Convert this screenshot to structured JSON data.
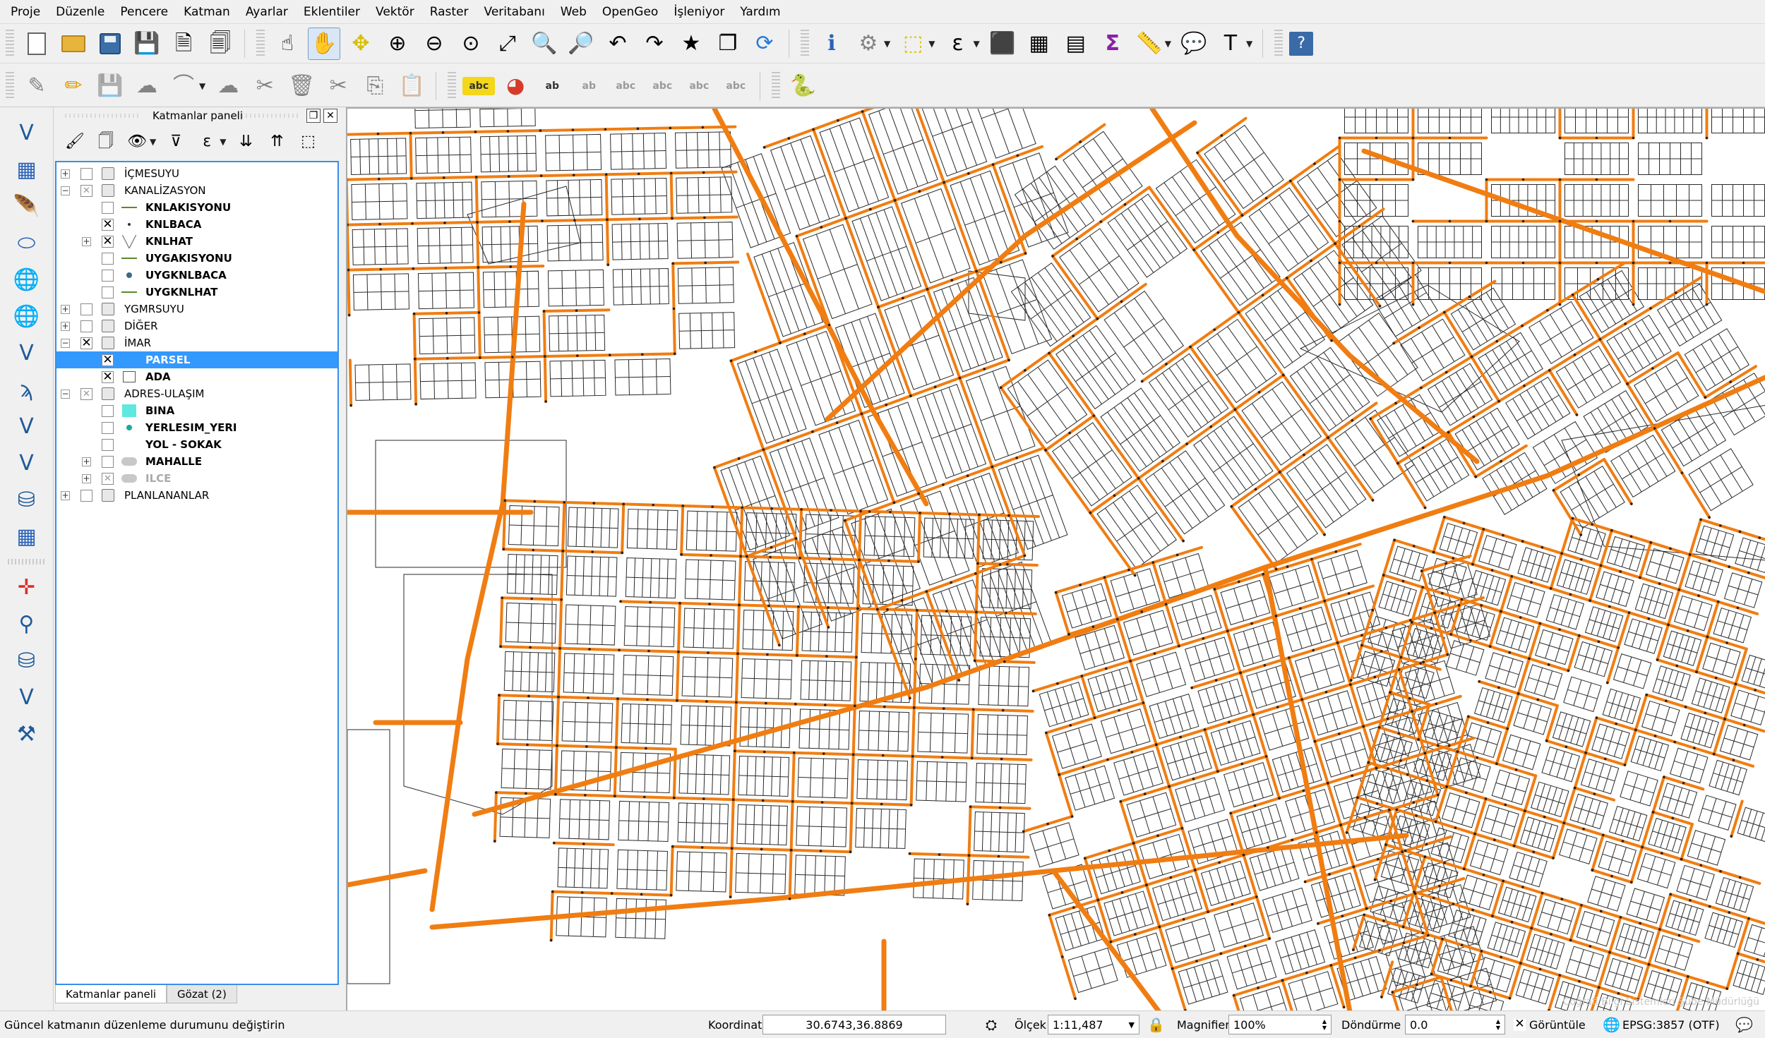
{
  "menu": [
    "Proje",
    "Düzenle",
    "Pencere",
    "Katman",
    "Ayarlar",
    "Eklentiler",
    "Vektör",
    "Raster",
    "Veritabanı",
    "Web",
    "OpenGeo",
    "İşleniyor",
    "Yardım"
  ],
  "toolbar1": [
    {
      "name": "new-project-icon",
      "glyph": ""
    },
    {
      "name": "open-project-icon",
      "glyph": ""
    },
    {
      "name": "save-project-icon",
      "glyph": ""
    },
    {
      "name": "save-as-icon",
      "glyph": "💾"
    },
    {
      "name": "new-print-composer-icon",
      "glyph": "🗎"
    },
    {
      "name": "composer-manager-icon",
      "glyph": "🗐"
    },
    {
      "name": "touch-zoom-icon",
      "glyph": "☝"
    },
    {
      "name": "pan-map-icon",
      "glyph": "✋",
      "active": true
    },
    {
      "name": "pan-to-selection-icon",
      "glyph": "✥"
    },
    {
      "name": "zoom-in-icon",
      "glyph": "⊕"
    },
    {
      "name": "zoom-out-icon",
      "glyph": "⊖"
    },
    {
      "name": "zoom-native-icon",
      "glyph": "⊙"
    },
    {
      "name": "zoom-full-icon",
      "glyph": "⤢"
    },
    {
      "name": "zoom-to-selection-icon",
      "glyph": "🔍"
    },
    {
      "name": "zoom-to-layer-icon",
      "glyph": "🔎"
    },
    {
      "name": "zoom-last-icon",
      "glyph": "↶"
    },
    {
      "name": "zoom-next-icon",
      "glyph": "↷"
    },
    {
      "name": "new-bookmark-icon",
      "glyph": "★"
    },
    {
      "name": "show-bookmarks-icon",
      "glyph": "❐"
    },
    {
      "name": "refresh-icon",
      "glyph": "⟳"
    },
    {
      "name": "identify-icon",
      "glyph": "ℹ"
    },
    {
      "name": "map-tips-icon",
      "glyph": "⚙",
      "dim": true,
      "dropdown": true
    },
    {
      "name": "select-features-icon",
      "glyph": "⬚",
      "dropdown": true
    },
    {
      "name": "select-by-expression-icon",
      "glyph": "ε",
      "dropdown": true
    },
    {
      "name": "deselect-all-icon",
      "glyph": "⬛"
    },
    {
      "name": "attribute-table-icon",
      "glyph": "▦"
    },
    {
      "name": "field-calculator-icon",
      "glyph": "▤"
    },
    {
      "name": "statistics-sum-icon",
      "glyph": "Σ"
    },
    {
      "name": "measure-line-icon",
      "glyph": "📏",
      "dropdown": true
    },
    {
      "name": "text-annotation-icon",
      "glyph": "💬"
    },
    {
      "name": "text-tool-icon",
      "glyph": "T",
      "dropdown": true
    },
    {
      "name": "help-icon",
      "glyph": "?"
    }
  ],
  "toolbar2": [
    {
      "name": "current-edits-icon",
      "glyph": "✎",
      "dim": true
    },
    {
      "name": "toggle-editing-icon",
      "glyph": "✏"
    },
    {
      "name": "save-layer-edits-icon",
      "glyph": "💾",
      "dim": true
    },
    {
      "name": "add-feature-icon",
      "glyph": "☁",
      "dim": true
    },
    {
      "name": "add-circular-string-icon",
      "glyph": "⌒",
      "dim": true,
      "dropdown": true
    },
    {
      "name": "move-feature-icon",
      "glyph": "☁",
      "dim": true
    },
    {
      "name": "node-tool-icon",
      "glyph": "✂",
      "dim": true
    },
    {
      "name": "delete-selected-icon",
      "glyph": "🗑",
      "dim": true
    },
    {
      "name": "cut-features-icon",
      "glyph": "✂",
      "dim": true
    },
    {
      "name": "copy-features-icon",
      "glyph": "⎘",
      "dim": true
    },
    {
      "name": "paste-features-icon",
      "glyph": "📋",
      "dim": true
    },
    {
      "name": "labeling-icon",
      "glyph": "abc"
    },
    {
      "name": "diagram-icon",
      "glyph": "◕"
    },
    {
      "name": "pin-labels-icon",
      "glyph": "ab"
    },
    {
      "name": "highlight-pinned-labels-icon",
      "glyph": "ab",
      "dim": true
    },
    {
      "name": "show-hide-labels-icon",
      "glyph": "abc",
      "dim": true
    },
    {
      "name": "move-label-icon",
      "glyph": "abc",
      "dim": true
    },
    {
      "name": "rotate-label-icon",
      "glyph": "abc",
      "dim": true
    },
    {
      "name": "change-label-icon",
      "glyph": "abc",
      "dim": true
    },
    {
      "name": "python-console-icon",
      "glyph": "🐍"
    }
  ],
  "leftbar": [
    {
      "name": "add-vector-layer-icon",
      "glyph": "V"
    },
    {
      "name": "add-raster-layer-icon",
      "glyph": "▦"
    },
    {
      "name": "add-delimited-text-icon",
      "glyph": "🪶"
    },
    {
      "name": "add-spatialite-layer-icon",
      "glyph": "⬭",
      "dropdown": true
    },
    {
      "name": "add-wms-layer-icon",
      "glyph": "🌐",
      "dropdown": true
    },
    {
      "name": "add-wcs-layer-icon",
      "glyph": "🌐"
    },
    {
      "name": "add-wfs-layer-icon",
      "glyph": "V",
      "dropdown": true
    },
    {
      "name": "add-csv-layer-icon",
      "glyph": "ϡ"
    },
    {
      "name": "new-shapefile-icon",
      "glyph": "V"
    },
    {
      "name": "new-spatialite-layer-icon",
      "glyph": "V",
      "dropdown": true
    },
    {
      "name": "add-wms-tile-icon",
      "glyph": "⛁"
    },
    {
      "name": "add-virtual-layer-icon",
      "glyph": "▦"
    },
    {
      "name": "sep",
      "glyph": ""
    },
    {
      "name": "coordinate-capture-icon",
      "glyph": "✛"
    },
    {
      "name": "georeferencer-icon",
      "glyph": "⚲"
    },
    {
      "name": "gps-tools-icon",
      "glyph": "⛁"
    },
    {
      "name": "vertex-editor-icon",
      "glyph": "V"
    },
    {
      "name": "processing-toolbox-icon",
      "glyph": "⚒"
    }
  ],
  "layers_panel": {
    "title": "Katmanlar paneli",
    "tools": [
      {
        "name": "open-layer-styling-icon",
        "glyph": "🖌"
      },
      {
        "name": "add-group-icon",
        "glyph": "🗍"
      },
      {
        "name": "manage-visibility-icon",
        "glyph": "👁",
        "dropdown": true
      },
      {
        "name": "filter-legend-icon",
        "glyph": "⊽"
      },
      {
        "name": "filter-by-expression-icon",
        "glyph": "ε",
        "dropdown": true
      },
      {
        "name": "expand-all-icon",
        "glyph": "⇊"
      },
      {
        "name": "collapse-all-icon",
        "glyph": "⇈"
      },
      {
        "name": "remove-layer-icon",
        "glyph": "⬚"
      }
    ],
    "tree": [
      {
        "label": "İÇMESUYU",
        "level": 0,
        "type": "group",
        "expander": "+",
        "check": ""
      },
      {
        "label": "KANALİZASYON",
        "level": 0,
        "type": "group",
        "expander": "−",
        "check": "partial"
      },
      {
        "label": "KNLAKISYONU",
        "level": 1,
        "type": "layer",
        "check": "",
        "symbol": "line",
        "bold": true
      },
      {
        "label": "KNLBACA",
        "level": 1,
        "type": "layer",
        "check": "x",
        "symbol": "dot-small",
        "bold": true
      },
      {
        "label": "KNLHAT",
        "level": 1,
        "type": "layer",
        "check": "x",
        "symbol": "v",
        "bold": true,
        "expander": "+"
      },
      {
        "label": "UYGAKISYONU",
        "level": 1,
        "type": "layer",
        "check": "",
        "symbol": "line",
        "bold": true
      },
      {
        "label": "UYGKNLBACA",
        "level": 1,
        "type": "layer",
        "check": "",
        "symbol": "dot",
        "bold": true
      },
      {
        "label": "UYGKNLHAT",
        "level": 1,
        "type": "layer",
        "check": "",
        "symbol": "line",
        "bold": true
      },
      {
        "label": "YGMRSUYU",
        "level": 0,
        "type": "group",
        "expander": "+",
        "check": ""
      },
      {
        "label": "DİĞER",
        "level": 0,
        "type": "group",
        "expander": "+",
        "check": ""
      },
      {
        "label": "İMAR",
        "level": 0,
        "type": "group",
        "expander": "−",
        "check": "x"
      },
      {
        "label": "PARSEL",
        "level": 1,
        "type": "layer",
        "check": "x",
        "symbol": "none",
        "bold": true,
        "selected": true
      },
      {
        "label": "ADA",
        "level": 1,
        "type": "layer",
        "check": "x",
        "symbol": "box",
        "bold": true
      },
      {
        "label": "ADRES-ULAŞIM",
        "level": 0,
        "type": "group",
        "expander": "−",
        "check": "partial"
      },
      {
        "label": "BINA",
        "level": 1,
        "type": "layer",
        "check": "",
        "symbol": "fill-cyan",
        "bold": true
      },
      {
        "label": "YERLESIM_YERI",
        "level": 1,
        "type": "layer",
        "check": "",
        "symbol": "dot-teal",
        "bold": true
      },
      {
        "label": "YOL - SOKAK",
        "level": 1,
        "type": "layer",
        "check": "",
        "symbol": "none",
        "bold": true
      },
      {
        "label": "MAHALLE",
        "level": 1,
        "type": "layer",
        "check": "",
        "symbol": "cloud",
        "bold": true,
        "expander": "+"
      },
      {
        "label": "ILCE",
        "level": 1,
        "type": "layer",
        "check": "partial",
        "symbol": "cloud",
        "bold": true,
        "expander": "+",
        "gray": true
      },
      {
        "label": "PLANLANANLAR",
        "level": 0,
        "type": "group",
        "expander": "+",
        "check": ""
      }
    ],
    "tabs": [
      "Katmanlar paneli",
      "Gözat (2)"
    ]
  },
  "map": {
    "attribution": "Coğrafi Bilgi Sistemleri Şube Müdürlüğü",
    "road_color": "#f07d12",
    "parcel_color": "#2a2a2a"
  },
  "status": {
    "message": "Güncel katmanın düzenleme durumunu değiştirin",
    "coord_label": "Koordinat",
    "coord_value": "30.6743,36.8869",
    "scale_label": "Ölçek",
    "scale_value": "1:11,487",
    "magnifier_label": "Magnifier",
    "magnifier_value": "100%",
    "rotation_label": "Döndürme",
    "rotation_value": "0.0",
    "render_label": "Görüntüle",
    "crs_label": "EPSG:3857 (OTF)"
  }
}
